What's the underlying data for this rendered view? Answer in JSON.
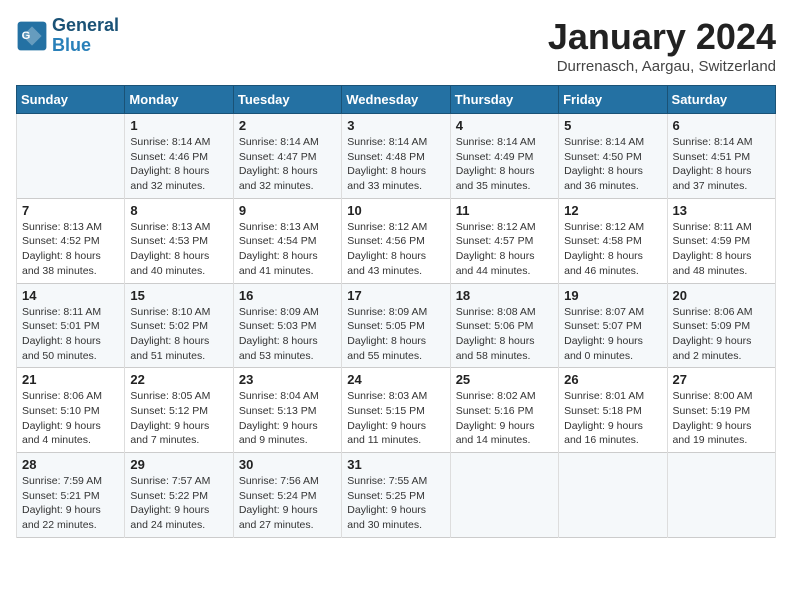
{
  "logo": {
    "line1": "General",
    "line2": "Blue"
  },
  "title": "January 2024",
  "location": "Durrenasch, Aargau, Switzerland",
  "weekdays": [
    "Sunday",
    "Monday",
    "Tuesday",
    "Wednesday",
    "Thursday",
    "Friday",
    "Saturday"
  ],
  "weeks": [
    [
      {
        "day": "",
        "info": ""
      },
      {
        "day": "1",
        "info": "Sunrise: 8:14 AM\nSunset: 4:46 PM\nDaylight: 8 hours\nand 32 minutes."
      },
      {
        "day": "2",
        "info": "Sunrise: 8:14 AM\nSunset: 4:47 PM\nDaylight: 8 hours\nand 32 minutes."
      },
      {
        "day": "3",
        "info": "Sunrise: 8:14 AM\nSunset: 4:48 PM\nDaylight: 8 hours\nand 33 minutes."
      },
      {
        "day": "4",
        "info": "Sunrise: 8:14 AM\nSunset: 4:49 PM\nDaylight: 8 hours\nand 35 minutes."
      },
      {
        "day": "5",
        "info": "Sunrise: 8:14 AM\nSunset: 4:50 PM\nDaylight: 8 hours\nand 36 minutes."
      },
      {
        "day": "6",
        "info": "Sunrise: 8:14 AM\nSunset: 4:51 PM\nDaylight: 8 hours\nand 37 minutes."
      }
    ],
    [
      {
        "day": "7",
        "info": "Sunrise: 8:13 AM\nSunset: 4:52 PM\nDaylight: 8 hours\nand 38 minutes."
      },
      {
        "day": "8",
        "info": "Sunrise: 8:13 AM\nSunset: 4:53 PM\nDaylight: 8 hours\nand 40 minutes."
      },
      {
        "day": "9",
        "info": "Sunrise: 8:13 AM\nSunset: 4:54 PM\nDaylight: 8 hours\nand 41 minutes."
      },
      {
        "day": "10",
        "info": "Sunrise: 8:12 AM\nSunset: 4:56 PM\nDaylight: 8 hours\nand 43 minutes."
      },
      {
        "day": "11",
        "info": "Sunrise: 8:12 AM\nSunset: 4:57 PM\nDaylight: 8 hours\nand 44 minutes."
      },
      {
        "day": "12",
        "info": "Sunrise: 8:12 AM\nSunset: 4:58 PM\nDaylight: 8 hours\nand 46 minutes."
      },
      {
        "day": "13",
        "info": "Sunrise: 8:11 AM\nSunset: 4:59 PM\nDaylight: 8 hours\nand 48 minutes."
      }
    ],
    [
      {
        "day": "14",
        "info": "Sunrise: 8:11 AM\nSunset: 5:01 PM\nDaylight: 8 hours\nand 50 minutes."
      },
      {
        "day": "15",
        "info": "Sunrise: 8:10 AM\nSunset: 5:02 PM\nDaylight: 8 hours\nand 51 minutes."
      },
      {
        "day": "16",
        "info": "Sunrise: 8:09 AM\nSunset: 5:03 PM\nDaylight: 8 hours\nand 53 minutes."
      },
      {
        "day": "17",
        "info": "Sunrise: 8:09 AM\nSunset: 5:05 PM\nDaylight: 8 hours\nand 55 minutes."
      },
      {
        "day": "18",
        "info": "Sunrise: 8:08 AM\nSunset: 5:06 PM\nDaylight: 8 hours\nand 58 minutes."
      },
      {
        "day": "19",
        "info": "Sunrise: 8:07 AM\nSunset: 5:07 PM\nDaylight: 9 hours\nand 0 minutes."
      },
      {
        "day": "20",
        "info": "Sunrise: 8:06 AM\nSunset: 5:09 PM\nDaylight: 9 hours\nand 2 minutes."
      }
    ],
    [
      {
        "day": "21",
        "info": "Sunrise: 8:06 AM\nSunset: 5:10 PM\nDaylight: 9 hours\nand 4 minutes."
      },
      {
        "day": "22",
        "info": "Sunrise: 8:05 AM\nSunset: 5:12 PM\nDaylight: 9 hours\nand 7 minutes."
      },
      {
        "day": "23",
        "info": "Sunrise: 8:04 AM\nSunset: 5:13 PM\nDaylight: 9 hours\nand 9 minutes."
      },
      {
        "day": "24",
        "info": "Sunrise: 8:03 AM\nSunset: 5:15 PM\nDaylight: 9 hours\nand 11 minutes."
      },
      {
        "day": "25",
        "info": "Sunrise: 8:02 AM\nSunset: 5:16 PM\nDaylight: 9 hours\nand 14 minutes."
      },
      {
        "day": "26",
        "info": "Sunrise: 8:01 AM\nSunset: 5:18 PM\nDaylight: 9 hours\nand 16 minutes."
      },
      {
        "day": "27",
        "info": "Sunrise: 8:00 AM\nSunset: 5:19 PM\nDaylight: 9 hours\nand 19 minutes."
      }
    ],
    [
      {
        "day": "28",
        "info": "Sunrise: 7:59 AM\nSunset: 5:21 PM\nDaylight: 9 hours\nand 22 minutes."
      },
      {
        "day": "29",
        "info": "Sunrise: 7:57 AM\nSunset: 5:22 PM\nDaylight: 9 hours\nand 24 minutes."
      },
      {
        "day": "30",
        "info": "Sunrise: 7:56 AM\nSunset: 5:24 PM\nDaylight: 9 hours\nand 27 minutes."
      },
      {
        "day": "31",
        "info": "Sunrise: 7:55 AM\nSunset: 5:25 PM\nDaylight: 9 hours\nand 30 minutes."
      },
      {
        "day": "",
        "info": ""
      },
      {
        "day": "",
        "info": ""
      },
      {
        "day": "",
        "info": ""
      }
    ]
  ]
}
